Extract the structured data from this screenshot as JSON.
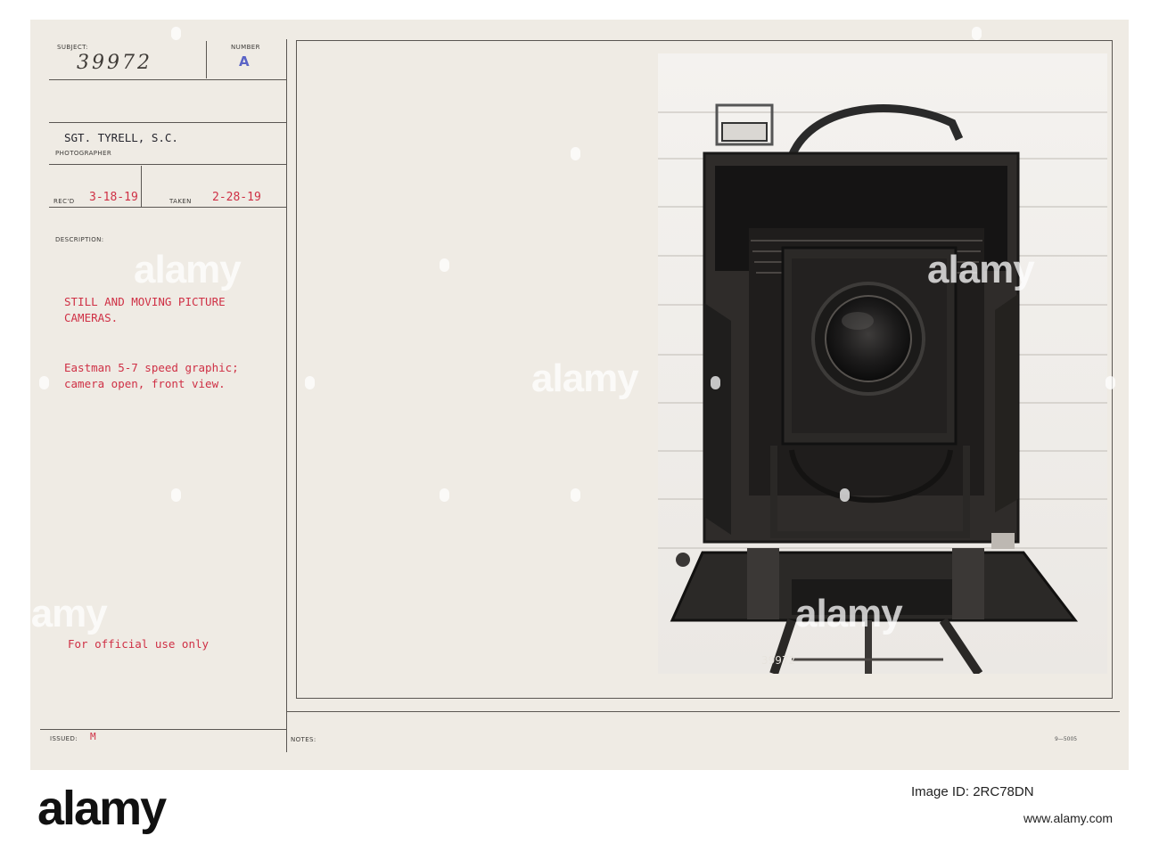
{
  "card": {
    "subject_label": "SUBJECT:",
    "subject_number": "39972",
    "number_label": "NUMBER",
    "number_value": "A",
    "photographer_name": "SGT. TYRELL, S.C.",
    "photographer_label": "PHOTOGRAPHER",
    "recd_label": "REC'D",
    "recd_value": "3-18-19",
    "taken_label": "TAKEN",
    "taken_value": "2-28-19",
    "description_label": "DESCRIPTION:",
    "description_title": "STILL AND MOVING PICTURE\nCAMERAS.",
    "description_body": "Eastman 5-7 speed graphic;\ncamera open, front view.",
    "official_use": "For official use only",
    "issued_label": "ISSUED:",
    "issued_value": "M",
    "notes_label": "NOTES:",
    "form_number": "9—5005"
  },
  "photo": {
    "negative_number": "39972",
    "subject_icon": "view-camera-icon"
  },
  "watermark": {
    "text": "alamy"
  },
  "footer": {
    "logo_text": "alamy",
    "image_id_label": "Image ID:",
    "image_id": "2RC78DN",
    "url": "www.alamy.com"
  },
  "colors": {
    "card_background": "#efebe4",
    "red_ink": "#cf3045",
    "rule_lines": "#5a5652"
  }
}
